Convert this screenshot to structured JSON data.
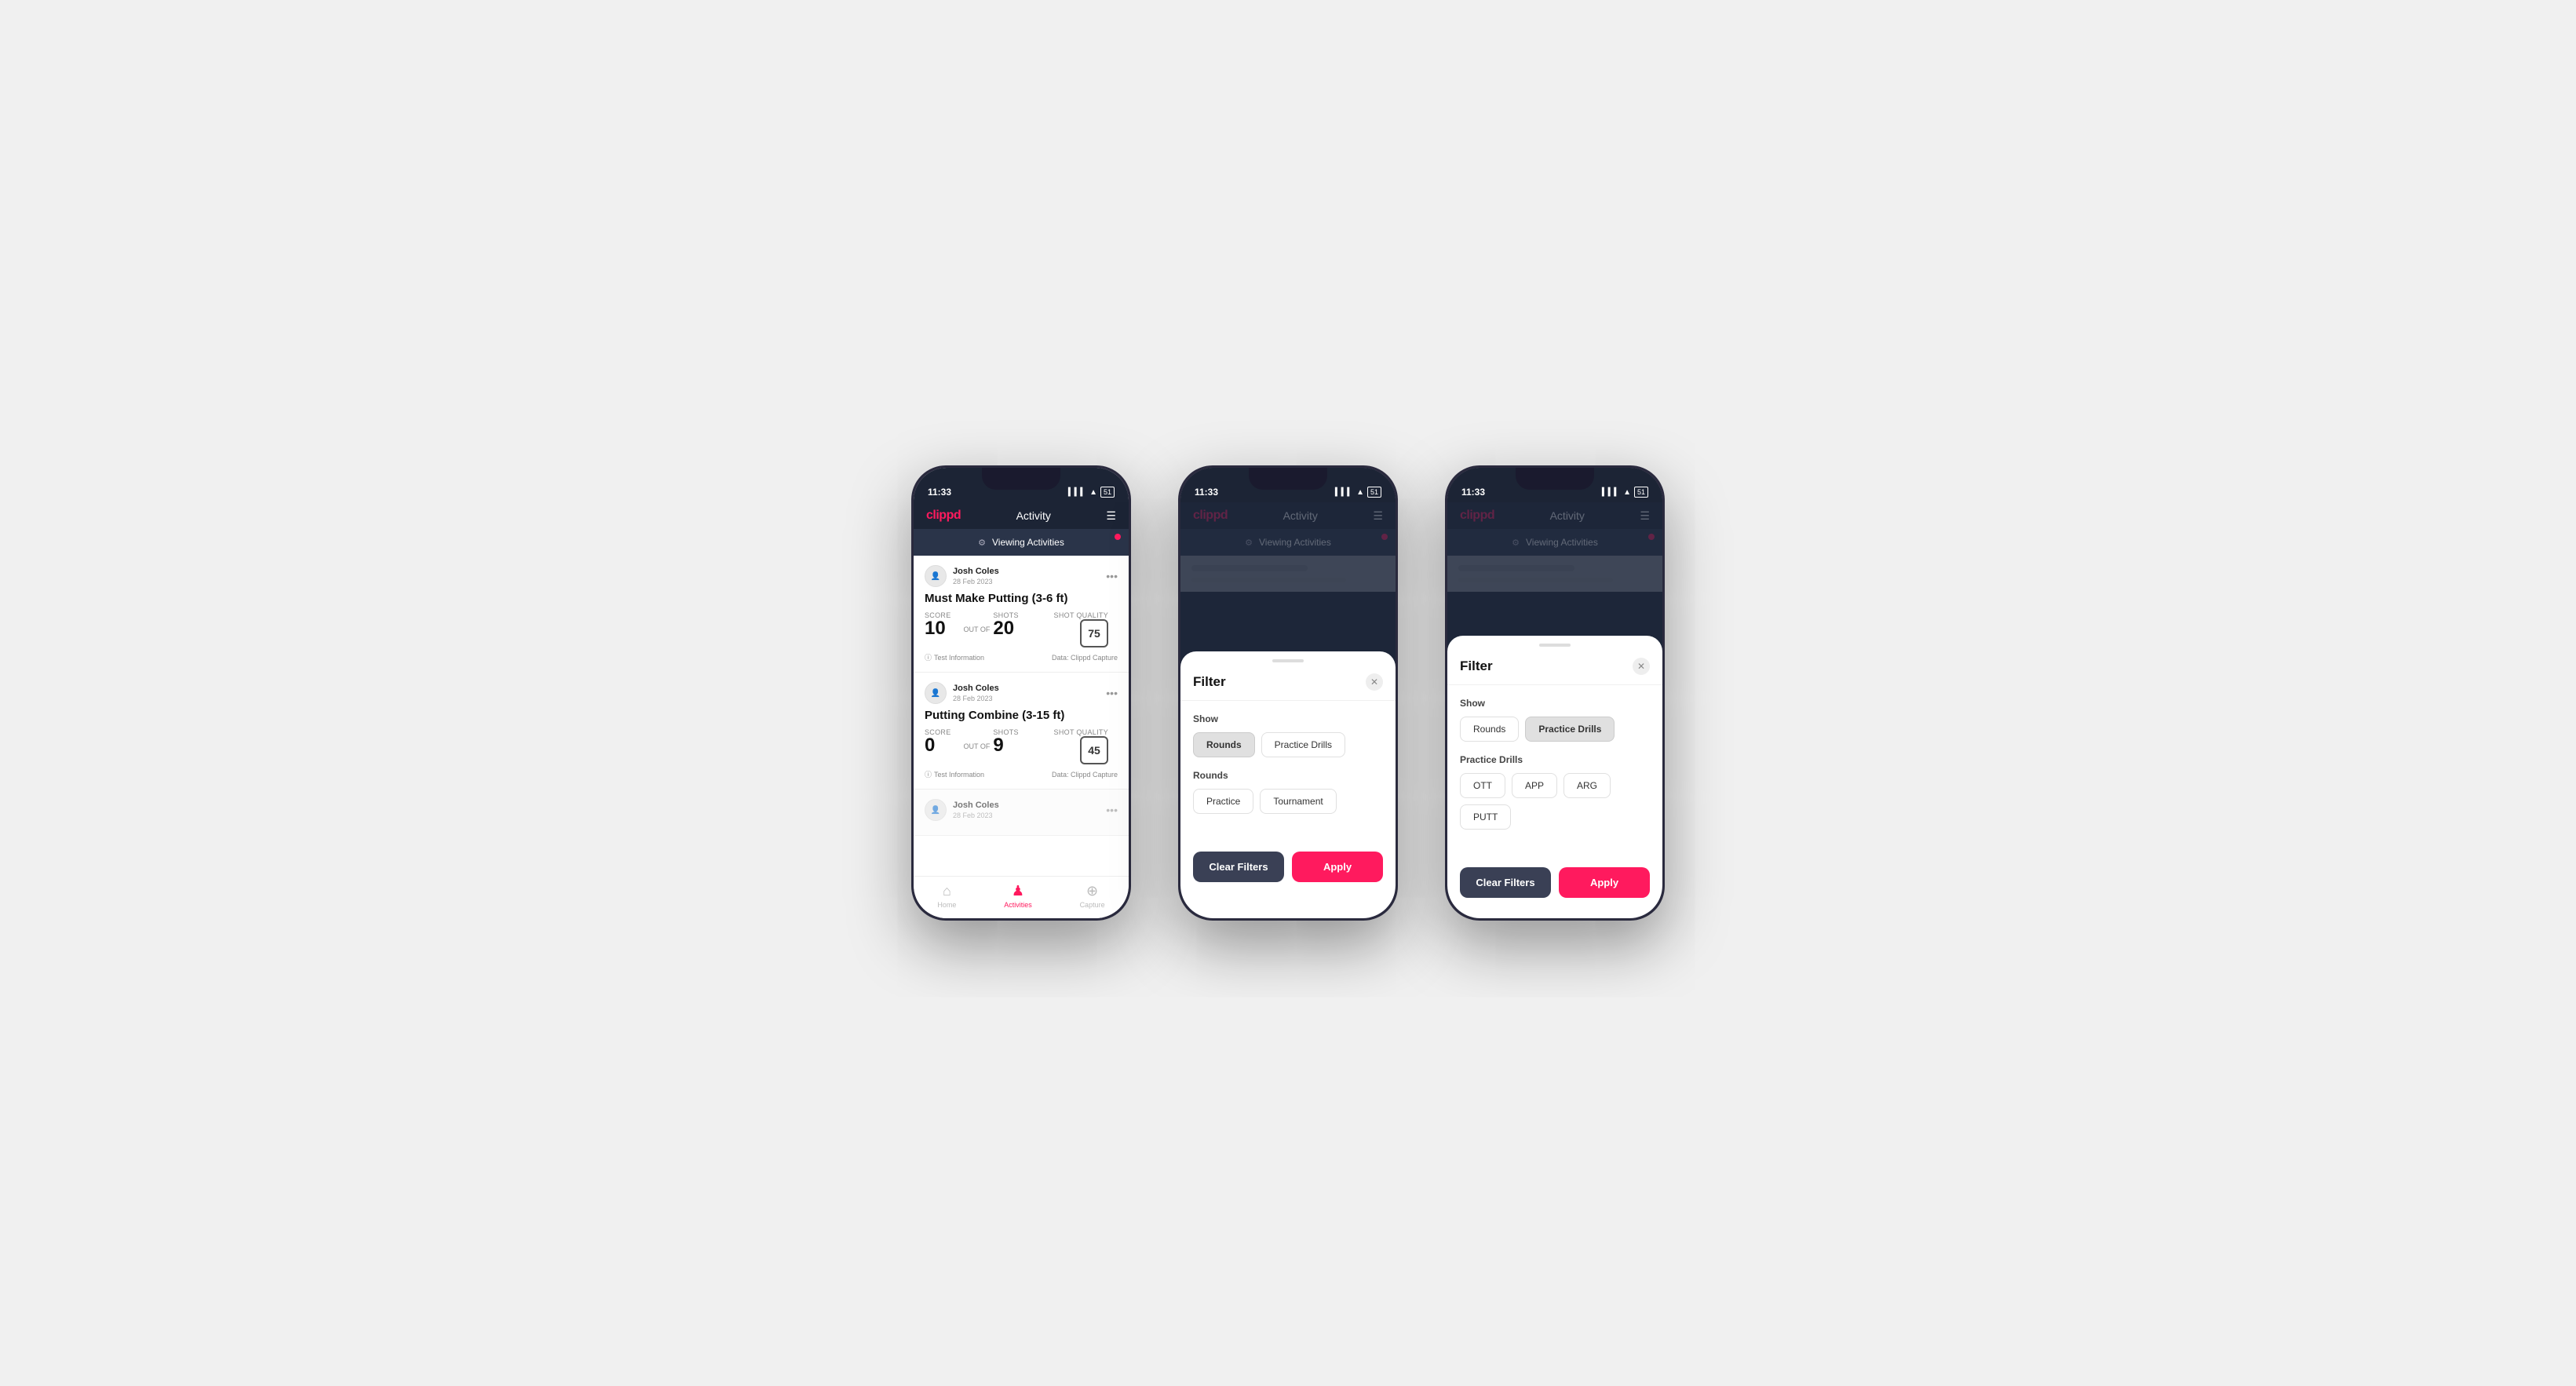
{
  "phones": {
    "phone1": {
      "statusTime": "11:33",
      "brand": "clippd",
      "navTitle": "Activity",
      "viewingText": "Viewing Activities",
      "cards": [
        {
          "userName": "Josh Coles",
          "userDate": "28 Feb 2023",
          "title": "Must Make Putting (3-6 ft)",
          "scoreLabel": "Score",
          "scoreValue": "10",
          "outOfLabel": "OUT OF",
          "shotsLabel": "Shots",
          "shotsValue": "20",
          "shotQualityLabel": "Shot Quality",
          "shotQualityValue": "75",
          "testInfo": "Test Information",
          "dataSource": "Data: Clippd Capture"
        },
        {
          "userName": "Josh Coles",
          "userDate": "28 Feb 2023",
          "title": "Putting Combine (3-15 ft)",
          "scoreLabel": "Score",
          "scoreValue": "0",
          "outOfLabel": "OUT OF",
          "shotsLabel": "Shots",
          "shotsValue": "9",
          "shotQualityLabel": "Shot Quality",
          "shotQualityValue": "45",
          "testInfo": "Test Information",
          "dataSource": "Data: Clippd Capture"
        }
      ],
      "bottomNav": [
        {
          "label": "Home",
          "icon": "🏠",
          "active": false
        },
        {
          "label": "Activities",
          "icon": "👤",
          "active": true
        },
        {
          "label": "Capture",
          "icon": "⊕",
          "active": false
        }
      ]
    },
    "phone2": {
      "statusTime": "11:33",
      "brand": "clippd",
      "navTitle": "Activity",
      "viewingText": "Viewing Activities",
      "modal": {
        "title": "Filter",
        "showLabel": "Show",
        "showButtons": [
          {
            "label": "Rounds",
            "active": true
          },
          {
            "label": "Practice Drills",
            "active": false
          }
        ],
        "roundsLabel": "Rounds",
        "roundsButtons": [
          {
            "label": "Practice",
            "active": false
          },
          {
            "label": "Tournament",
            "active": false
          }
        ],
        "clearFiltersLabel": "Clear Filters",
        "applyLabel": "Apply"
      }
    },
    "phone3": {
      "statusTime": "11:33",
      "brand": "clippd",
      "navTitle": "Activity",
      "viewingText": "Viewing Activities",
      "modal": {
        "title": "Filter",
        "showLabel": "Show",
        "showButtons": [
          {
            "label": "Rounds",
            "active": false
          },
          {
            "label": "Practice Drills",
            "active": true
          }
        ],
        "practiceDrillsLabel": "Practice Drills",
        "practiceDrillsButtons": [
          {
            "label": "OTT",
            "active": false
          },
          {
            "label": "APP",
            "active": false
          },
          {
            "label": "ARG",
            "active": false
          },
          {
            "label": "PUTT",
            "active": false
          }
        ],
        "clearFiltersLabel": "Clear Filters",
        "applyLabel": "Apply"
      }
    }
  }
}
